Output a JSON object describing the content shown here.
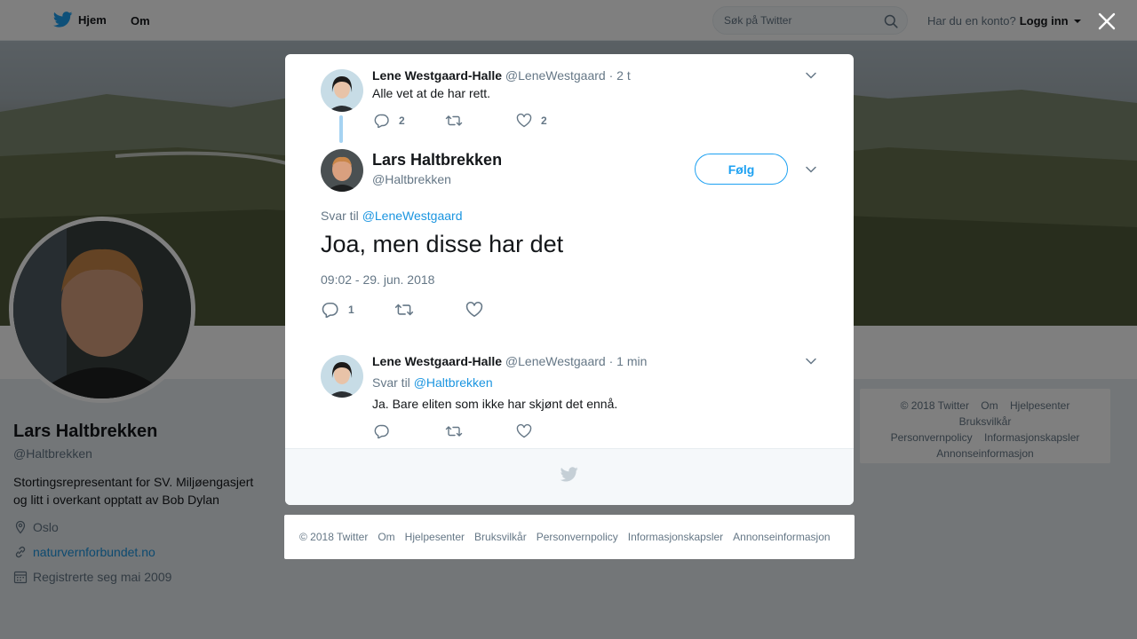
{
  "topbar": {
    "home_label": "Hjem",
    "about_label": "Om",
    "search_placeholder": "Søk på Twitter",
    "account_question": "Har du en konto?",
    "login_label": "Logg inn"
  },
  "profile": {
    "name": "Lars Haltbrekken",
    "handle": "@Haltbrekken",
    "bio": "Stortingsrepresentant for SV. Miljøengasjert og litt i overkant opptatt av Bob Dylan",
    "location": "Oslo",
    "website": "naturvernforbundet.no",
    "joined": "Registrerte seg mai 2009"
  },
  "side_footer": {
    "row1": [
      "© 2018 Twitter",
      "Om",
      "Hjelpesenter",
      "Bruksvilkår"
    ],
    "row2": [
      "Personvernpolicy",
      "Informasjonskapsler"
    ],
    "row3": [
      "Annonseinformasjon"
    ]
  },
  "modal": {
    "tweet1": {
      "name": "Lene Westgaard-Halle",
      "handle": "@LeneWestgaard",
      "time": "· 2 t",
      "text": "Alle vet at de har rett.",
      "replies": "2",
      "likes": "2"
    },
    "main": {
      "name": "Lars Haltbrekken",
      "handle": "@Haltbrekken",
      "follow_label": "Følg",
      "reply_prefix": "Svar til",
      "reply_handle": "@LeneWestgaard",
      "text": "Joa, men disse har det",
      "date": "09:02 - 29. jun. 2018",
      "replies": "1"
    },
    "tweet3": {
      "name": "Lene Westgaard-Halle",
      "handle": "@LeneWestgaard",
      "time": "· 1 min",
      "reply_prefix": "Svar til",
      "reply_handle": "@Haltbrekken",
      "text": "Ja. Bare eliten som ikke har skjønt det ennå."
    }
  },
  "bottom_footer": [
    "© 2018 Twitter",
    "Om",
    "Hjelpesenter",
    "Bruksvilkår",
    "Personvernpolicy",
    "Informasjonskapsler",
    "Annonseinformasjon"
  ],
  "colors": {
    "accent": "#1da1f2",
    "link": "#1b95e0",
    "muted": "#657786",
    "thread_line": "#a6d3f2"
  },
  "icons": [
    "twitter-bird-icon",
    "search-icon",
    "close-icon",
    "reply-icon",
    "retweet-icon",
    "like-icon",
    "chevron-down-icon",
    "location-icon",
    "link-icon",
    "calendar-icon"
  ]
}
